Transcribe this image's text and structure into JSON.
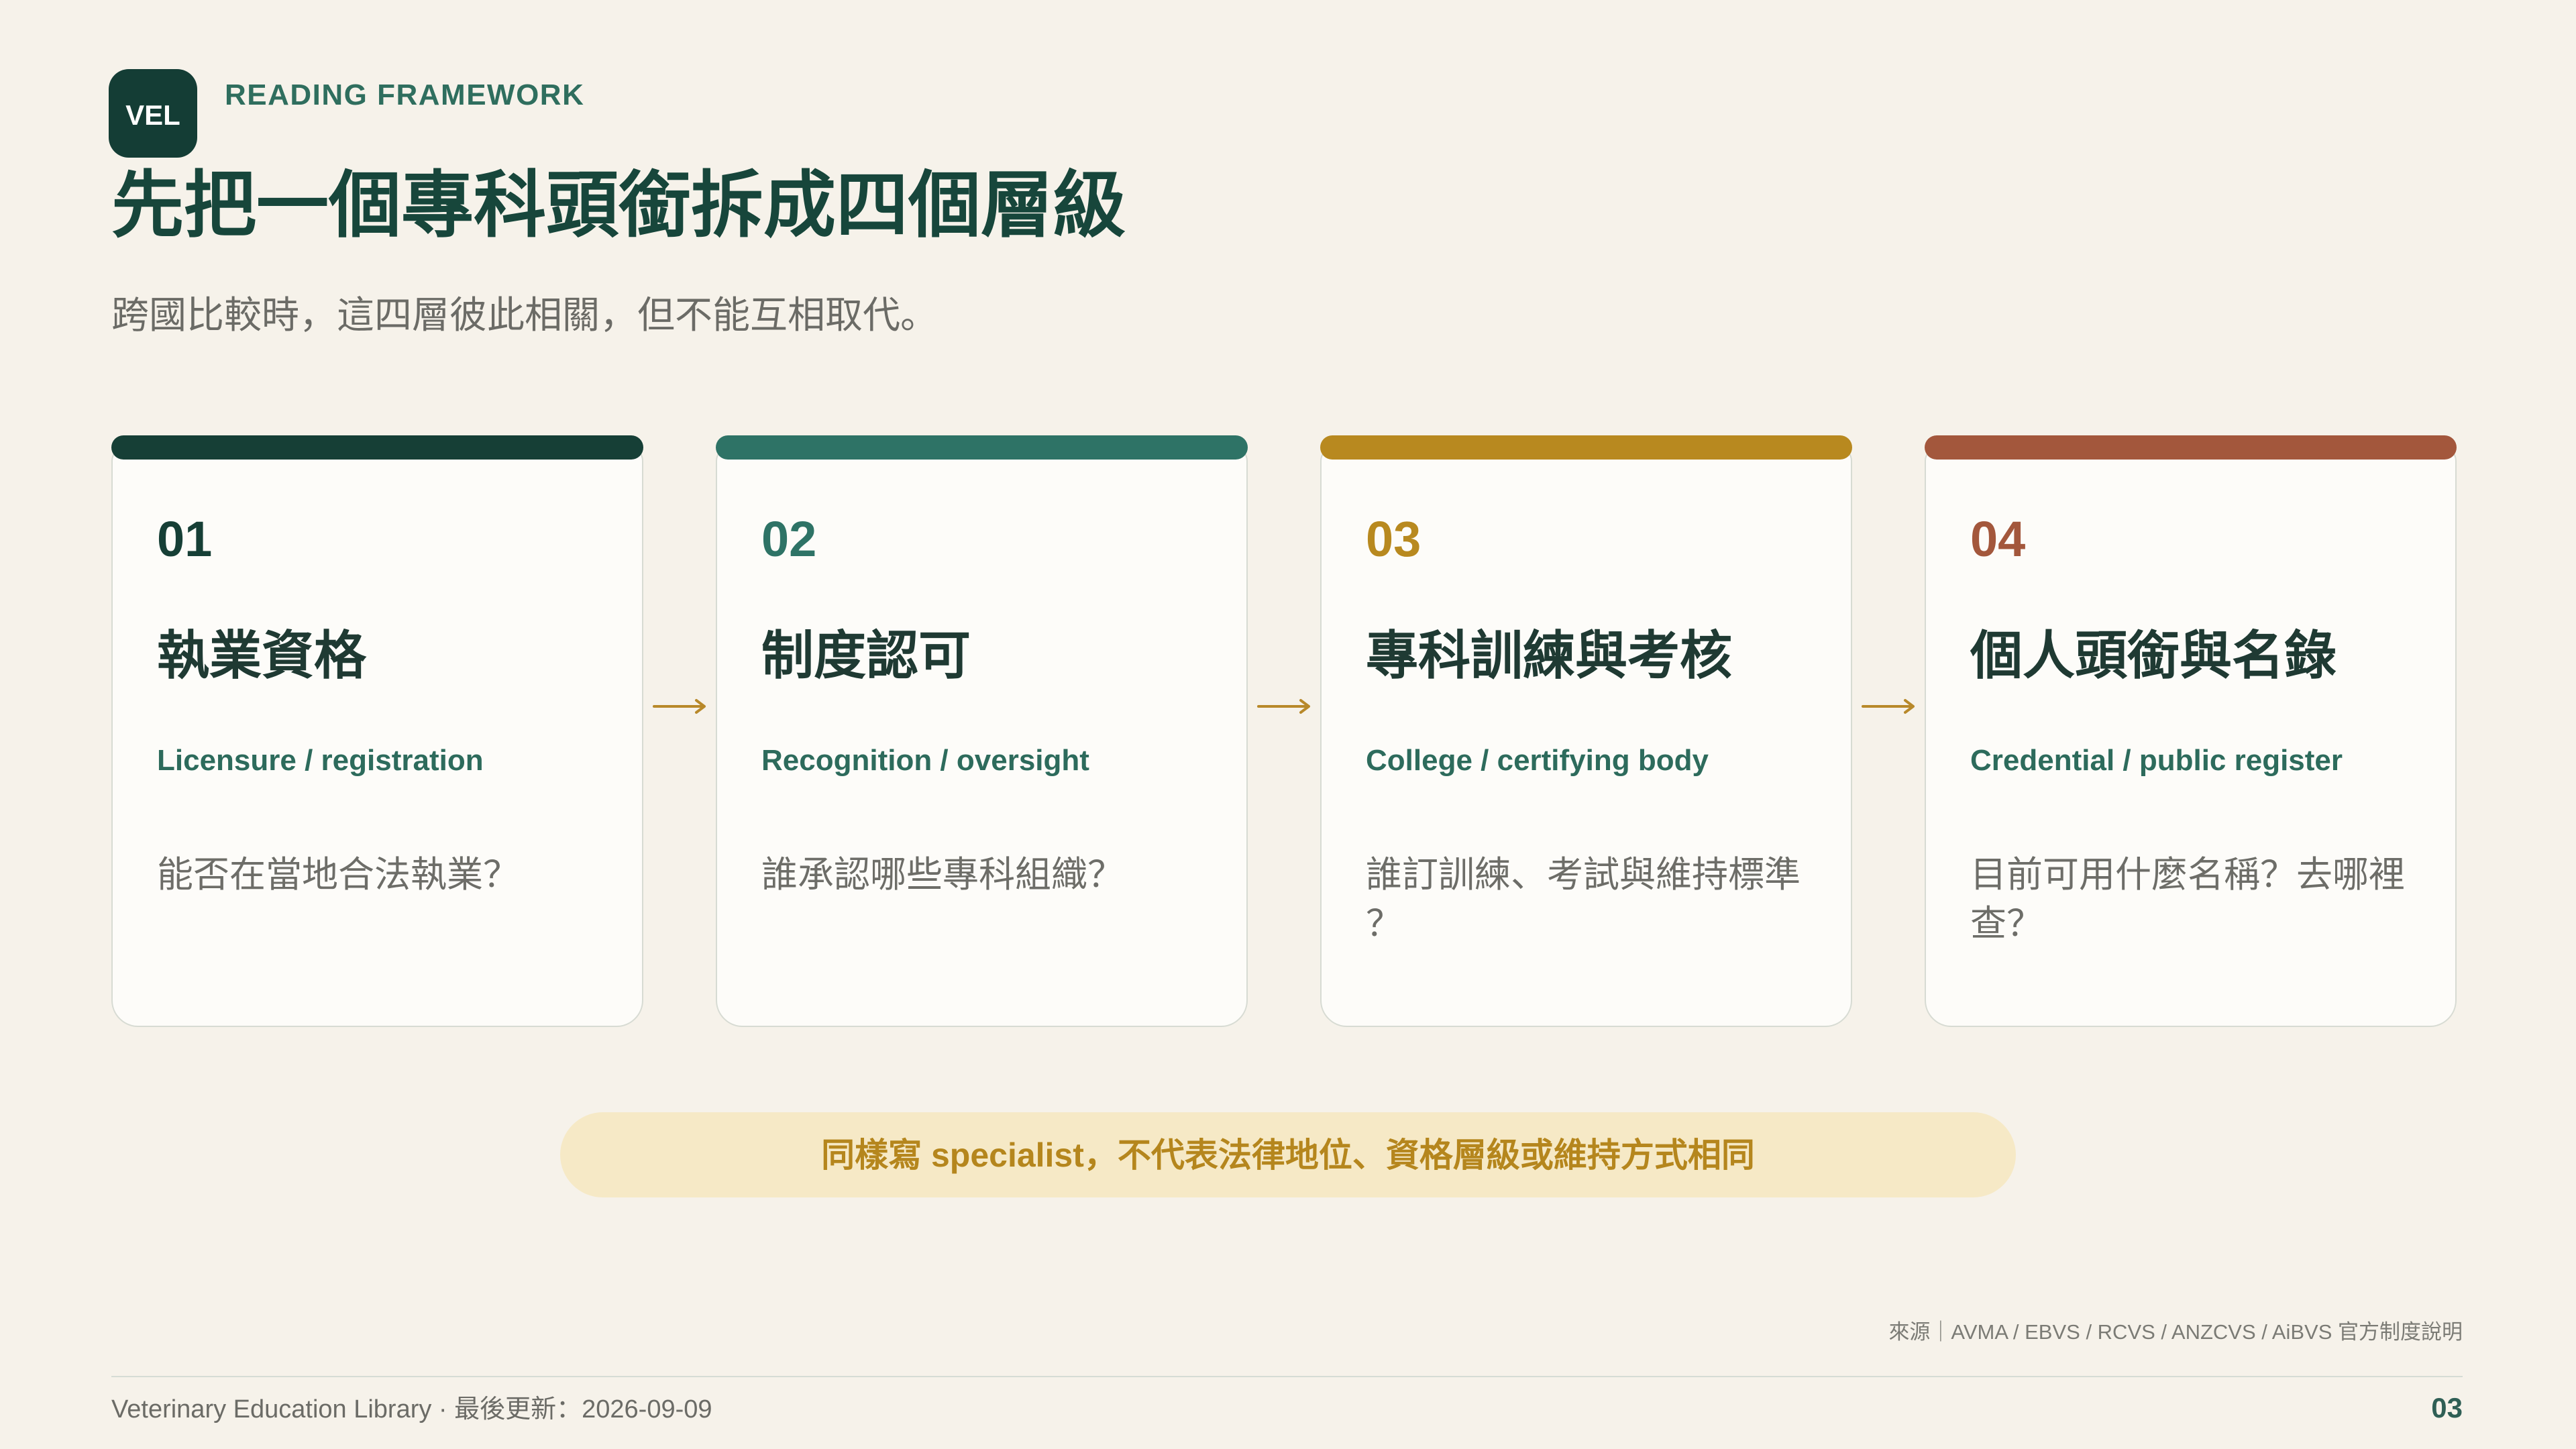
{
  "brand": {
    "badge": "VEL",
    "eyebrow": "READING FRAMEWORK"
  },
  "title": "先把一個專科頭銜拆成四個層級",
  "subtitle": "跨國比較時，這四層彼此相關，但不能互相取代。",
  "layers": [
    {
      "number": "01",
      "title": "執業資格",
      "english": "Licensure / registration",
      "question": "能否在當地合法執業？",
      "accent": "#163f36"
    },
    {
      "number": "02",
      "title": "制度認可",
      "english": "Recognition / oversight",
      "question": "誰承認哪些專科組織？",
      "accent": "#2e7366"
    },
    {
      "number": "03",
      "title": "專科訓練與考核",
      "english": "College / certifying body",
      "question": "誰訂訓練、考試與維持標準？",
      "accent": "#b8891f"
    },
    {
      "number": "04",
      "title": "個人頭銜與名錄",
      "english": "Credential / public register",
      "question": "目前可用什麼名稱？去哪裡查？",
      "accent": "#a3573c"
    }
  ],
  "connector_icon": "arrow-right-icon",
  "callout": "同樣寫 specialist，不代表法律地位、資格層級或維持方式相同",
  "source": "來源｜AVMA / EBVS / RCVS / ANZCVS / AiBVS 官方制度說明",
  "footer": {
    "left": "Veterinary Education Library · 最後更新：2026-09-09",
    "page": "03"
  },
  "colors": {
    "background": "#f6f2ea",
    "primary": "#143d35",
    "arrow": "#b8892a",
    "callout_bg": "#f6e9c6",
    "callout_text": "#b5861d"
  }
}
